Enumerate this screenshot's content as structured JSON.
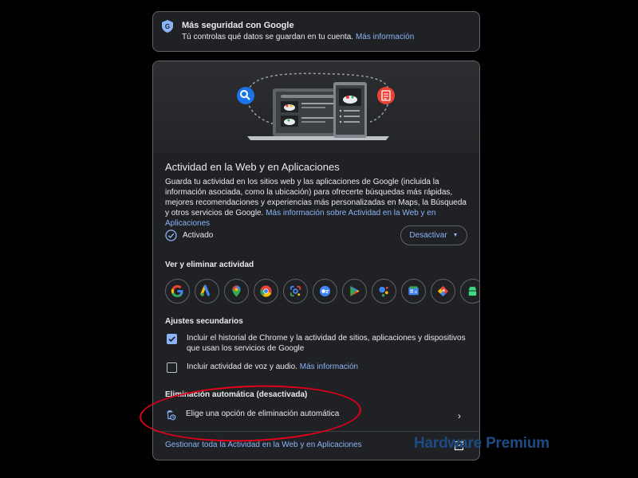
{
  "security_card": {
    "title": "Más seguridad con Google",
    "subtitle": "Tú controlas qué datos se guardan en tu cuenta.",
    "link": "Más información"
  },
  "activity": {
    "title": "Actividad en la Web y en Aplicaciones",
    "description": "Guarda tu actividad en los sitios web y las aplicaciones de Google (incluida la información asociada, como la ubicación) para ofrecerte búsquedas más rápidas, mejores recomendaciones y experiencias más personalizadas en Maps, la Búsqueda y otros servicios de Google.",
    "description_link": "Más información sobre Actividad en la Web y en Aplicaciones",
    "status_label": "Activado",
    "deactivate_label": "Desactivar"
  },
  "view_delete": {
    "heading": "Ver y eliminar actividad",
    "apps": [
      "google-icon",
      "ads-icon",
      "maps-icon",
      "chrome-icon",
      "lens-icon",
      "discover-icon",
      "play-icon",
      "assistant-icon",
      "news-icon",
      "shopping-icon",
      "android-icon"
    ]
  },
  "secondary": {
    "heading": "Ajustes secundarios",
    "option1": {
      "label": "Incluir el historial de Chrome y la actividad de sitios, aplicaciones y dispositivos que usan los servicios de Google",
      "checked": true
    },
    "option2": {
      "label": "Incluir actividad de voz y audio.",
      "link": "Más información",
      "checked": false
    }
  },
  "auto_delete": {
    "heading": "Eliminación automática (desactivada)",
    "option_label": "Elige una opción de eliminación automática"
  },
  "footer": {
    "manage_link": "Gestionar toda la Actividad en la Web y en Aplicaciones"
  },
  "watermark": "Hardware Premium",
  "colors": {
    "background": "#000000",
    "card": "#202124",
    "link": "#8ab4f8",
    "highlight_ellipse": "#e0001b",
    "watermark": "#1e4a86"
  }
}
